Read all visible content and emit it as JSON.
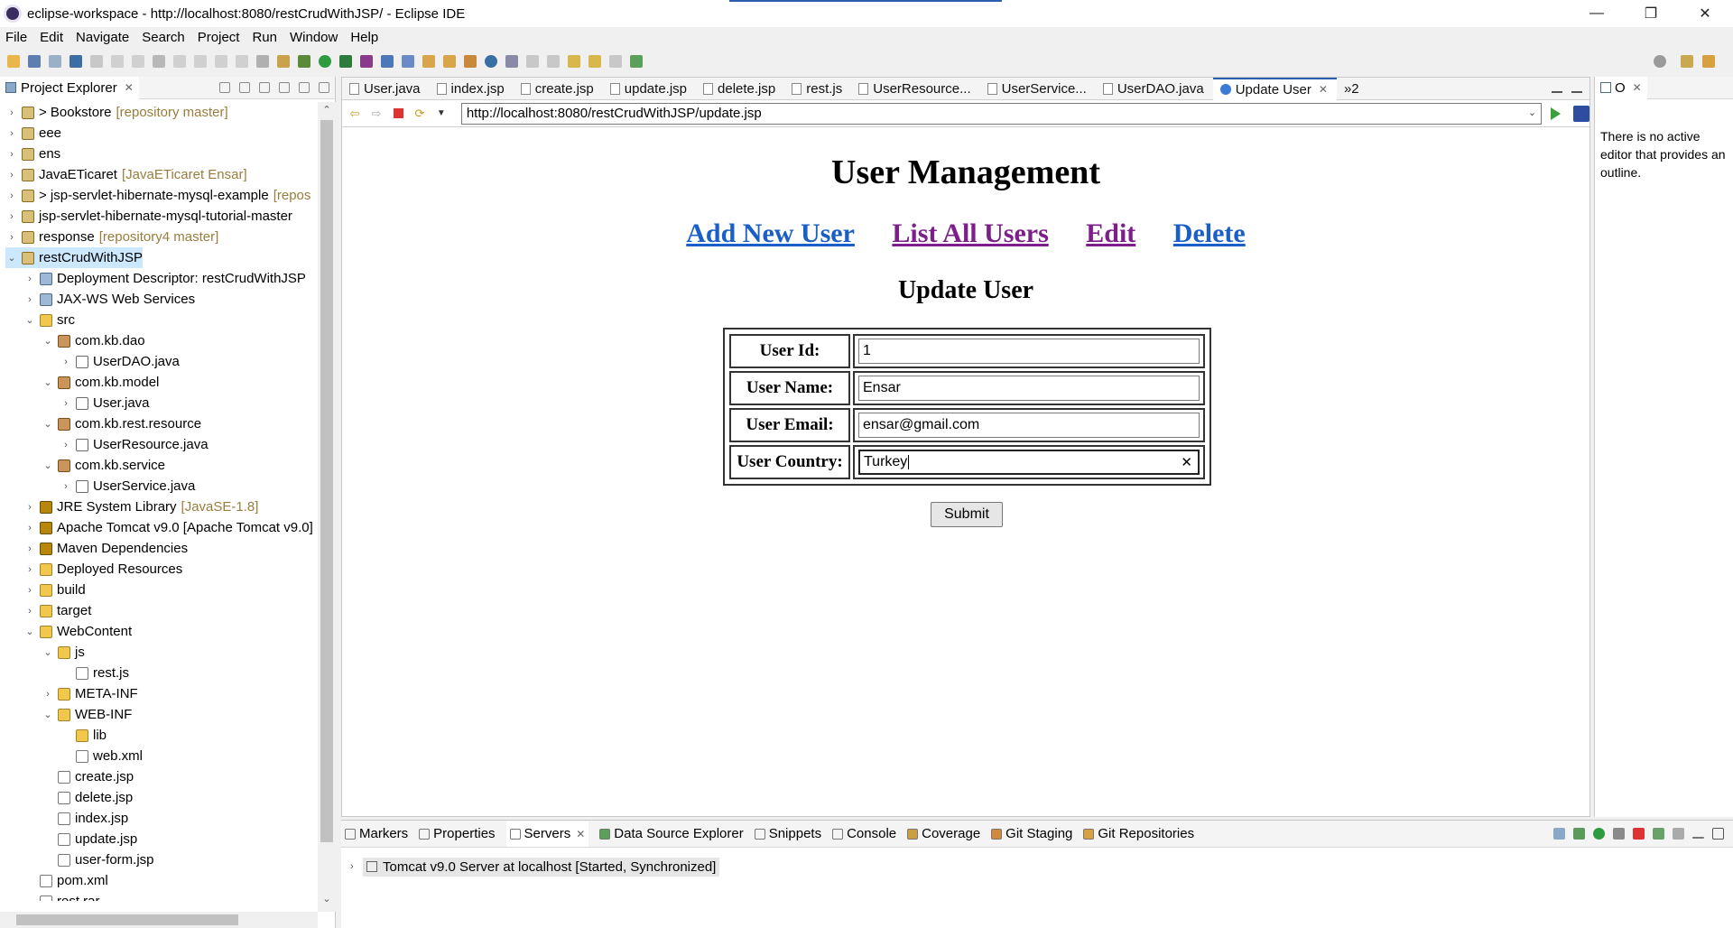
{
  "window": {
    "title": "eclipse-workspace - http://localhost:8080/restCrudWithJSP/ - Eclipse IDE",
    "controls": {
      "minimize": "—",
      "restore": "❐",
      "close": "✕"
    }
  },
  "menu": [
    "File",
    "Edit",
    "Navigate",
    "Search",
    "Project",
    "Run",
    "Window",
    "Help"
  ],
  "explorer": {
    "title": "Project Explorer",
    "items": [
      {
        "label": "> Bookstore",
        "deco": "[repository master]",
        "icon": "project-icon",
        "arrow": "›"
      },
      {
        "label": "eee",
        "deco": "",
        "icon": "project-icon",
        "arrow": "›"
      },
      {
        "label": "ens",
        "deco": "",
        "icon": "project-icon",
        "arrow": "›"
      },
      {
        "label": "JavaETicaret",
        "deco": "[JavaETicaret Ensar]",
        "icon": "project-icon",
        "arrow": "›"
      },
      {
        "label": "> jsp-servlet-hibernate-mysql-example",
        "deco": "[repos",
        "icon": "project-icon",
        "arrow": "›"
      },
      {
        "label": "jsp-servlet-hibernate-mysql-tutorial-master",
        "deco": "",
        "icon": "project-icon",
        "arrow": "›"
      },
      {
        "label": "response",
        "deco": "[repository4 master]",
        "icon": "project-icon",
        "arrow": "›"
      },
      {
        "label": "restCrudWithJSP",
        "deco": "",
        "icon": "project-icon",
        "arrow": "⌄"
      },
      {
        "label": "Deployment Descriptor: restCrudWithJSP",
        "deco": "",
        "icon": "web-icon",
        "arrow": "›"
      },
      {
        "label": "JAX-WS Web Services",
        "deco": "",
        "icon": "web-icon",
        "arrow": "›"
      },
      {
        "label": "src",
        "deco": "",
        "icon": "folder-icon",
        "arrow": "⌄"
      },
      {
        "label": "com.kb.dao",
        "deco": "",
        "icon": "package-icon",
        "arrow": "⌄"
      },
      {
        "label": "UserDAO.java",
        "deco": "",
        "icon": "java-file-icon",
        "arrow": "›"
      },
      {
        "label": "com.kb.model",
        "deco": "",
        "icon": "package-icon",
        "arrow": "⌄"
      },
      {
        "label": "User.java",
        "deco": "",
        "icon": "java-file-icon",
        "arrow": "›"
      },
      {
        "label": "com.kb.rest.resource",
        "deco": "",
        "icon": "package-icon",
        "arrow": "⌄"
      },
      {
        "label": "UserResource.java",
        "deco": "",
        "icon": "java-file-icon",
        "arrow": "›"
      },
      {
        "label": "com.kb.service",
        "deco": "",
        "icon": "package-icon",
        "arrow": "⌄"
      },
      {
        "label": "UserService.java",
        "deco": "",
        "icon": "java-file-icon",
        "arrow": "›"
      },
      {
        "label": "JRE System Library",
        "deco": "[JavaSE-1.8]",
        "icon": "library-icon",
        "arrow": "›"
      },
      {
        "label": "Apache Tomcat v9.0 [Apache Tomcat v9.0]",
        "deco": "",
        "icon": "library-icon",
        "arrow": "›"
      },
      {
        "label": "Maven Dependencies",
        "deco": "",
        "icon": "library-icon",
        "arrow": "›"
      },
      {
        "label": "Deployed Resources",
        "deco": "",
        "icon": "folder-icon",
        "arrow": "›"
      },
      {
        "label": "build",
        "deco": "",
        "icon": "folder-icon",
        "arrow": "›"
      },
      {
        "label": "target",
        "deco": "",
        "icon": "folder-icon",
        "arrow": "›"
      },
      {
        "label": "WebContent",
        "deco": "",
        "icon": "folder-icon",
        "arrow": "⌄"
      },
      {
        "label": "js",
        "deco": "",
        "icon": "folder-icon",
        "arrow": "⌄"
      },
      {
        "label": "rest.js",
        "deco": "",
        "icon": "file-icon",
        "arrow": ""
      },
      {
        "label": "META-INF",
        "deco": "",
        "icon": "folder-icon",
        "arrow": "›"
      },
      {
        "label": "WEB-INF",
        "deco": "",
        "icon": "folder-icon",
        "arrow": "⌄"
      },
      {
        "label": "lib",
        "deco": "",
        "icon": "folder-icon",
        "arrow": ""
      },
      {
        "label": "web.xml",
        "deco": "",
        "icon": "file-icon",
        "arrow": ""
      },
      {
        "label": "create.jsp",
        "deco": "",
        "icon": "file-icon",
        "arrow": ""
      },
      {
        "label": "delete.jsp",
        "deco": "",
        "icon": "file-icon",
        "arrow": ""
      },
      {
        "label": "index.jsp",
        "deco": "",
        "icon": "file-icon",
        "arrow": ""
      },
      {
        "label": "update.jsp",
        "deco": "",
        "icon": "file-icon",
        "arrow": ""
      },
      {
        "label": "user-form.jsp",
        "deco": "",
        "icon": "file-icon",
        "arrow": ""
      },
      {
        "label": "pom.xml",
        "deco": "",
        "icon": "file-icon",
        "arrow": ""
      },
      {
        "label": "rest.rar",
        "deco": "",
        "icon": "file-icon",
        "arrow": ""
      }
    ]
  },
  "editor": {
    "tabs": [
      "User.java",
      "index.jsp",
      "create.jsp",
      "update.jsp",
      "delete.jsp",
      "rest.js",
      "UserResource...",
      "UserService...",
      "UserDAO.java",
      "Update User"
    ],
    "overflow": "»2",
    "url": "http://localhost:8080/restCrudWithJSP/update.jsp"
  },
  "webpage": {
    "heading": "User Management",
    "links": [
      "Add New User",
      "List All Users",
      "Edit",
      "Delete"
    ],
    "subheading": "Update User",
    "fields": [
      {
        "label": "User Id:",
        "value": "1"
      },
      {
        "label": "User Name:",
        "value": "Ensar"
      },
      {
        "label": "User Email:",
        "value": "ensar@gmail.com"
      },
      {
        "label": "User Country:",
        "value": "Turkey"
      }
    ],
    "submit": "Submit"
  },
  "outline": {
    "tab": "O",
    "message": "There is no active editor that provides an outline."
  },
  "bottom": {
    "tabs": [
      "Markers",
      "Properties",
      "Servers",
      "Data Source Explorer",
      "Snippets",
      "Console",
      "Coverage",
      "Git Staging",
      "Git Repositories"
    ],
    "server": "Tomcat v9.0 Server at localhost  [Started, Synchronized]"
  },
  "colors": {
    "link_unvisited": "#1a5fc8",
    "link_visited": "#7d1f8a",
    "accent": "#2a5fb0",
    "selection": "#cce8ff"
  }
}
